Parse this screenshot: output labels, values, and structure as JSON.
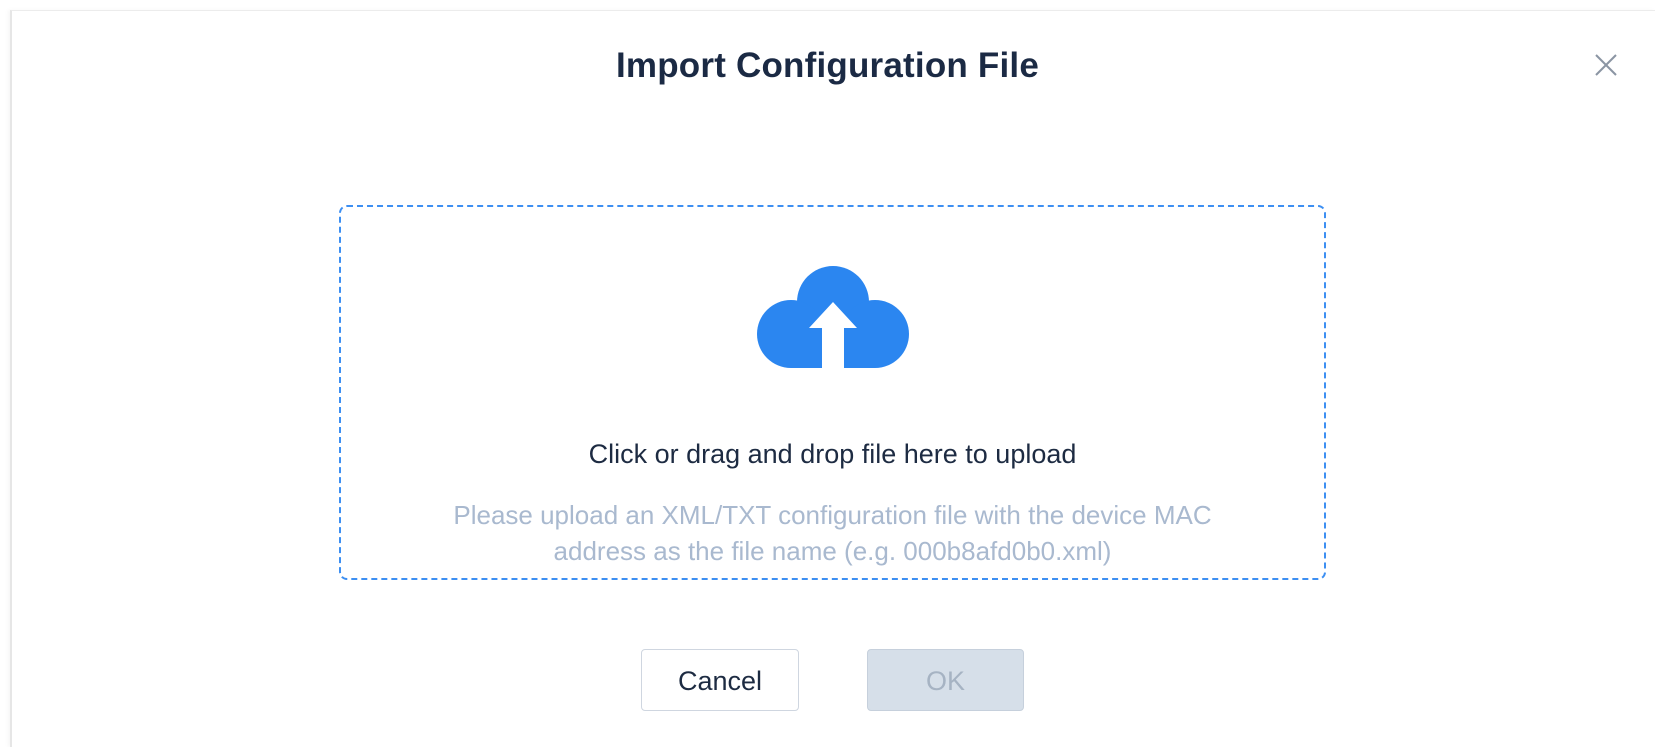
{
  "dialog": {
    "title": "Import Configuration File",
    "close_icon": "close-icon"
  },
  "upload": {
    "icon": "cloud-upload-icon",
    "icon_color": "#2b86f0",
    "border_color": "#3d8ff2",
    "primary_text": "Click or drag and drop file here to upload",
    "hint_line_1": "Please upload an XML/TXT configuration file with the device MAC",
    "hint_line_2": "address as the file name (e.g. 000b8afd0b0.xml)"
  },
  "actions": {
    "cancel_label": "Cancel",
    "ok_label": "OK",
    "ok_disabled": true
  }
}
